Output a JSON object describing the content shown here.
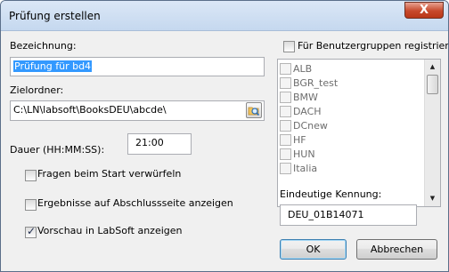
{
  "window": {
    "title": "Prüfung erstellen",
    "close_label": "X"
  },
  "form": {
    "bezeichnung_label": "Bezeichnung:",
    "bezeichnung_value": "Prüfung für bd4",
    "zielordner_label": "Zielordner:",
    "zielordner_value": "C:\\LN\\labsoft\\BooksDEU\\abcde\\",
    "dauer_label": "Dauer (HH:MM:SS):",
    "dauer_value": "21:00",
    "checkboxes": [
      {
        "label": "Fragen beim Start verwürfeln",
        "checked": false
      },
      {
        "label": "Ergebnisse auf Abschlussseite anzeigen",
        "checked": false
      },
      {
        "label": "Vorschau in LabSoft anzeigen",
        "checked": true
      }
    ]
  },
  "groups": {
    "register_label": "Für Benutzergruppen registrieren:",
    "register_checked": false,
    "items": [
      "ALB",
      "BGR_test",
      "BMW",
      "DACH",
      "DCnew",
      "HF",
      "HUN",
      "Italia"
    ]
  },
  "kennung": {
    "label": "Eindeutige Kennung:",
    "value": "DEU_01B14071"
  },
  "buttons": {
    "ok": "OK",
    "cancel": "Abbrechen"
  }
}
